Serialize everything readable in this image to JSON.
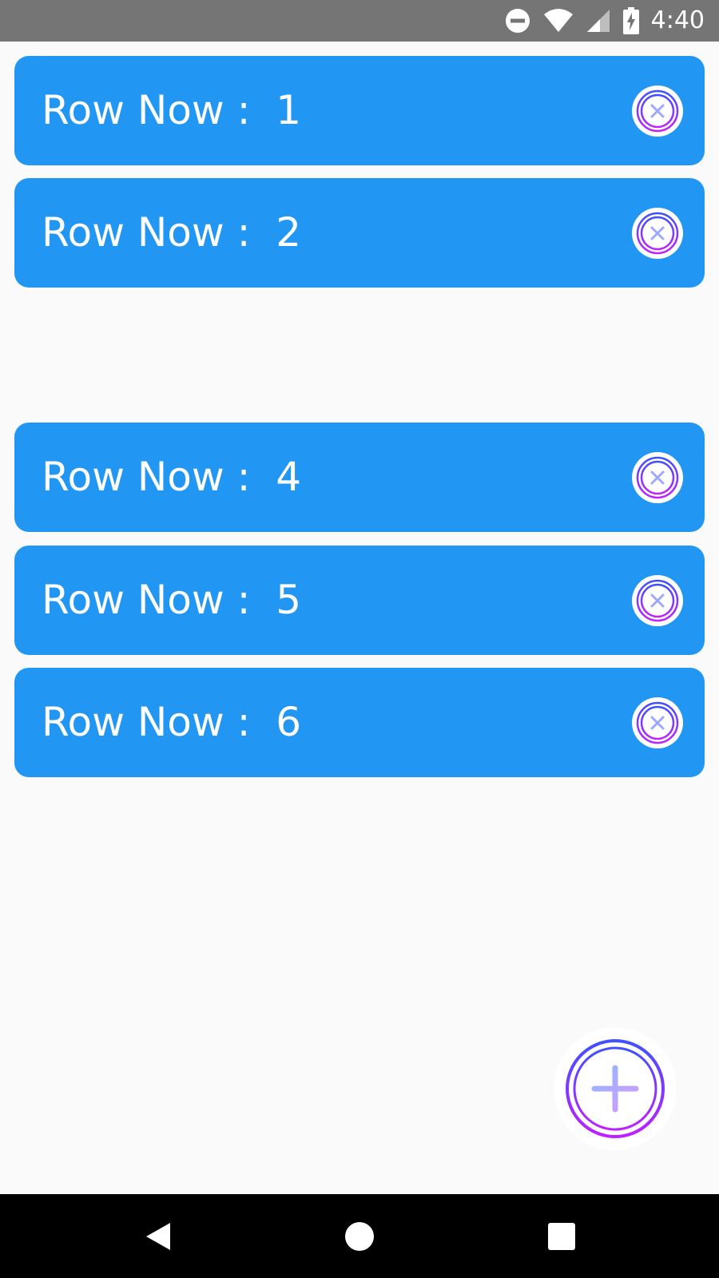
{
  "status_bar": {
    "time": "4:40",
    "icons": [
      "do-not-disturb-icon",
      "wifi-icon",
      "cell-signal-icon",
      "battery-charging-icon"
    ]
  },
  "rows": [
    {
      "label": "Row Now :  1"
    },
    {
      "label": "Row Now :  2"
    },
    {
      "label": "Row Now :  4"
    },
    {
      "label": "Row Now :  5"
    },
    {
      "label": "Row Now :  6"
    }
  ],
  "colors": {
    "row_background": "#2196f3",
    "status_bar": "#757575",
    "nav_bar": "#000000",
    "accent_gradient_start": "#3f51ff",
    "accent_gradient_end": "#c020ff"
  },
  "fab": {
    "icon": "plus-icon"
  },
  "nav": {
    "icons": [
      "back-icon",
      "home-icon",
      "recents-icon"
    ]
  }
}
